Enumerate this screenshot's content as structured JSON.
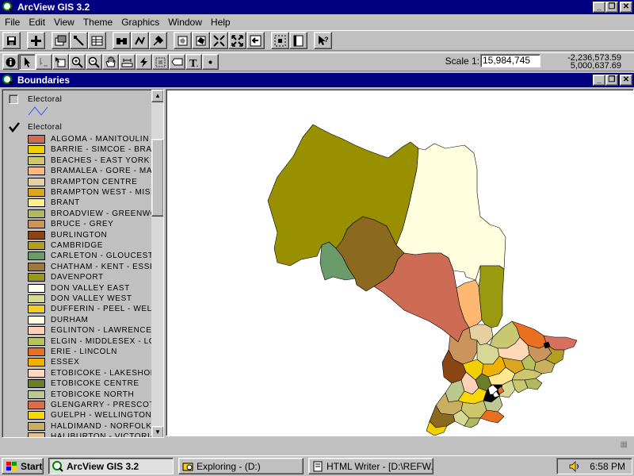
{
  "window": {
    "title": "ArcView GIS 3.2"
  },
  "menu": [
    "File",
    "Edit",
    "View",
    "Theme",
    "Graphics",
    "Window",
    "Help"
  ],
  "toolbar": {
    "buttons": [
      "save-icon",
      "add-theme-icon",
      "theme-properties-icon",
      "edit-legend-icon",
      "open-table-icon",
      "find-icon",
      "locate-address-icon",
      "query-builder-icon",
      "zoom-full-extent-icon",
      "zoom-to-themes-icon",
      "zoom-to-selected-icon",
      "zoom-in-icon",
      "zoom-out-icon",
      "zoom-previous-icon",
      "select-by-theme-icon",
      "layout-icon",
      "help-icon"
    ]
  },
  "tools": [
    "identify-icon",
    "pointer-icon",
    "vertex-edit-icon",
    "select-feature-icon",
    "zoom-in-tool-icon",
    "zoom-out-tool-icon",
    "pan-icon",
    "measure-icon",
    "hot-link-icon",
    "area-of-interest-icon",
    "label-icon",
    "text-icon",
    "draw-point-icon"
  ],
  "scale": {
    "label": "Scale 1:",
    "value": "15,984,745"
  },
  "coordinates": {
    "x": "-2,236,573.59",
    "y": "5,000,637.69"
  },
  "view": {
    "title": "Boundaries"
  },
  "toc": {
    "themes": [
      {
        "name": "Electoral",
        "checked": false,
        "symbol": "line"
      },
      {
        "name": "Electoral",
        "checked": true,
        "symbol": "polygon"
      }
    ],
    "legend": [
      {
        "label": "ALGOMA - MANITOULIN",
        "color": "#cd6b55"
      },
      {
        "label": "BARRIE - SIMCOE - BRADFORD",
        "color": "#f0d000"
      },
      {
        "label": "BEACHES - EAST YORK",
        "color": "#cdc66c"
      },
      {
        "label": "BRAMALEA - GORE - MALTON",
        "color": "#ffb87a"
      },
      {
        "label": "BRAMPTON CENTRE",
        "color": "#e6cfa0"
      },
      {
        "label": "BRAMPTON WEST - MISSISSAUGA",
        "color": "#daa520"
      },
      {
        "label": "BRANT",
        "color": "#fff08c"
      },
      {
        "label": "BROADVIEW - GREENWOOD",
        "color": "#b0b860"
      },
      {
        "label": "BRUCE - GREY",
        "color": "#c9955c"
      },
      {
        "label": "BURLINGTON",
        "color": "#8b4513"
      },
      {
        "label": "CAMBRIDGE",
        "color": "#b39e1f"
      },
      {
        "label": "CARLETON - GLOUCESTER",
        "color": "#6a9a6a"
      },
      {
        "label": "CHATHAM - KENT - ESSEX",
        "color": "#9a7840"
      },
      {
        "label": "DAVENPORT",
        "color": "#9a9a10"
      },
      {
        "label": "DON VALLEY EAST",
        "color": "#fffff0"
      },
      {
        "label": "DON VALLEY WEST",
        "color": "#d8d896"
      },
      {
        "label": "DUFFERIN - PEEL - WELLINGTON",
        "color": "#f0d020"
      },
      {
        "label": "DURHAM",
        "color": "#ffffe0"
      },
      {
        "label": "EGLINTON - LAWRENCE",
        "color": "#ffd0b8"
      },
      {
        "label": "ELGIN - MIDDLESEX - LONDON",
        "color": "#b8c060"
      },
      {
        "label": "ERIE - LINCOLN",
        "color": "#e87020"
      },
      {
        "label": "ESSEX",
        "color": "#f0b000"
      },
      {
        "label": "ETOBICOKE - LAKESHORE",
        "color": "#ffd8c0"
      },
      {
        "label": "ETOBICOKE CENTRE",
        "color": "#6b7d28"
      },
      {
        "label": "ETOBICOKE NORTH",
        "color": "#bcc890"
      },
      {
        "label": "GLENGARRY - PRESCOTT",
        "color": "#d87050"
      },
      {
        "label": "GUELPH - WELLINGTON",
        "color": "#f8d800"
      },
      {
        "label": "HALDIMAND - NORFOLK",
        "color": "#c8b060"
      },
      {
        "label": "HALIBURTON - VICTORIA",
        "color": "#e0c090"
      }
    ]
  },
  "taskbar": {
    "start": "Start",
    "tasks": [
      "ArcView GIS 3.2",
      "Exploring - (D:)",
      "HTML Writer - [D:\\REFW..."
    ],
    "clock": "6:58 PM"
  }
}
